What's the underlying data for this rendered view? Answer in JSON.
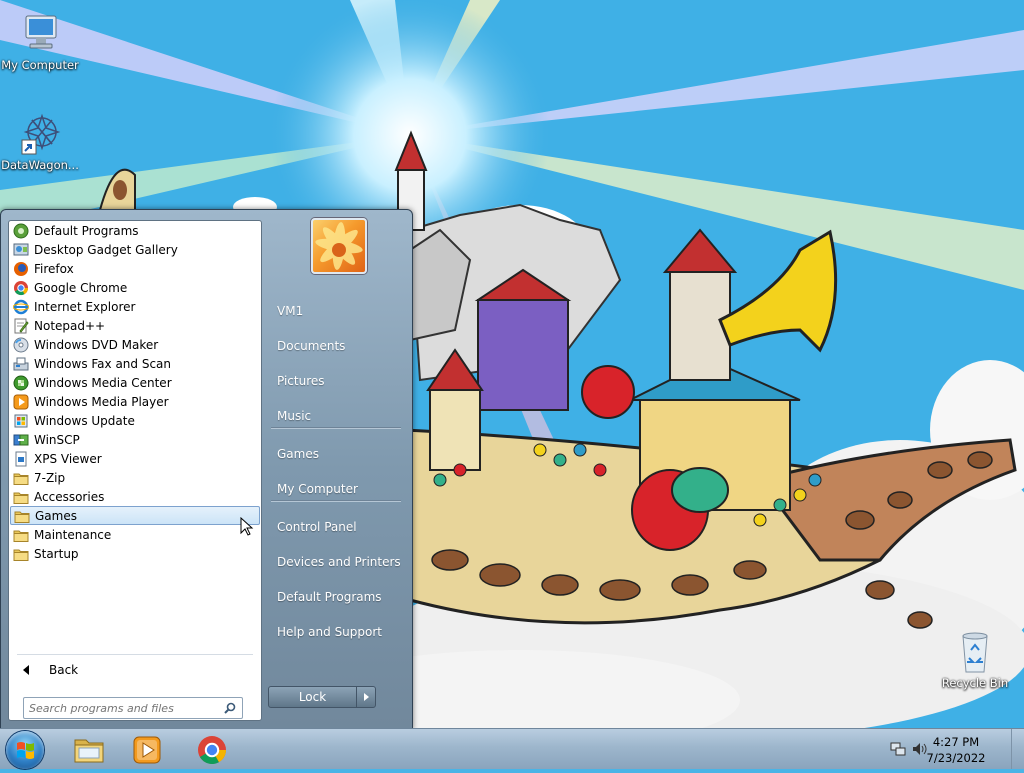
{
  "desktop": {
    "icons": [
      {
        "label": "My Computer",
        "icon": "computer-icon"
      },
      {
        "label": "DataWagon...",
        "icon": "datawagon-shortcut-icon"
      },
      {
        "label": "Recycle Bin",
        "icon": "recycle-bin-icon"
      }
    ]
  },
  "start_menu": {
    "programs": [
      {
        "label": "Default Programs",
        "icon": "default-programs-icon"
      },
      {
        "label": "Desktop Gadget Gallery",
        "icon": "gadget-gallery-icon"
      },
      {
        "label": "Firefox",
        "icon": "firefox-icon"
      },
      {
        "label": "Google Chrome",
        "icon": "chrome-icon"
      },
      {
        "label": "Internet Explorer",
        "icon": "internet-explorer-icon"
      },
      {
        "label": "Notepad++",
        "icon": "notepad-plus-plus-icon"
      },
      {
        "label": "Windows DVD Maker",
        "icon": "dvd-maker-icon"
      },
      {
        "label": "Windows Fax and Scan",
        "icon": "fax-scan-icon"
      },
      {
        "label": "Windows Media Center",
        "icon": "media-center-icon"
      },
      {
        "label": "Windows Media Player",
        "icon": "media-player-icon"
      },
      {
        "label": "Windows Update",
        "icon": "windows-update-icon"
      },
      {
        "label": "WinSCP",
        "icon": "winscp-icon"
      },
      {
        "label": "XPS Viewer",
        "icon": "xps-viewer-icon"
      },
      {
        "label": "7-Zip",
        "icon": "folder-icon"
      },
      {
        "label": "Accessories",
        "icon": "folder-icon"
      },
      {
        "label": "Games",
        "icon": "folder-icon",
        "selected": true
      },
      {
        "label": "Maintenance",
        "icon": "folder-icon"
      },
      {
        "label": "Startup",
        "icon": "folder-icon"
      }
    ],
    "back_label": "Back",
    "search_placeholder": "Search programs and files",
    "right_items": [
      "VM1",
      "Documents",
      "Pictures",
      "Music",
      "Games",
      "My Computer",
      "Control Panel",
      "Devices and Printers",
      "Default Programs",
      "Help and Support"
    ],
    "lock_label": "Lock"
  },
  "taskbar": {
    "pinned": [
      "windows-explorer-icon",
      "media-player-icon",
      "chrome-icon"
    ],
    "clock_time": "4:27 PM",
    "clock_date": "7/23/2022"
  },
  "colors": {
    "sky": "#4ab4e6",
    "selection": "#cce4f7",
    "start_menu_frame": "#7f99ae"
  }
}
